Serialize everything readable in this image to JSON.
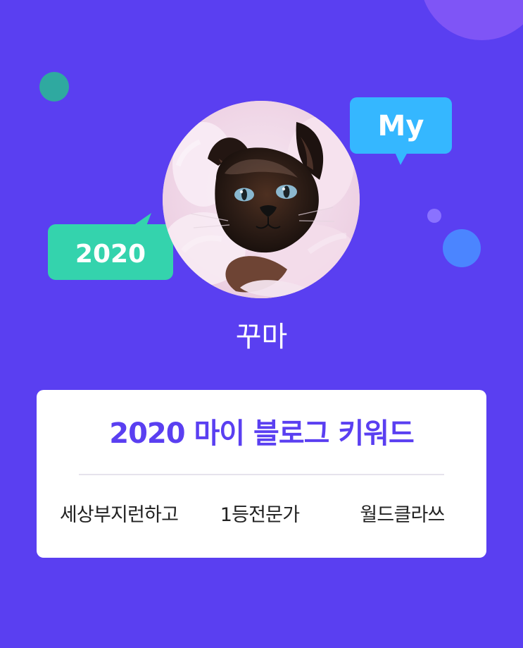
{
  "profile": {
    "nickname": "꾸마",
    "tag_my": "My",
    "tag_year": "2020"
  },
  "card": {
    "title": "2020 마이 블로그 키워드",
    "keywords": [
      "세상부지런하고",
      "1등전문가",
      "월드클라쓰"
    ]
  },
  "colors": {
    "background": "#5a3ff1",
    "card_title": "#5a3ff1",
    "my_tag": "#35b7ff",
    "year_tag": "#34d3ad",
    "blue_dot": "#4b85ff",
    "teal_dot": "#2fa9a0",
    "bubble": "#7f55f6"
  },
  "icons": {
    "my_tag": "speech-bubble-icon",
    "year_tag": "speech-bubble-icon",
    "avatar": "cat-photo"
  }
}
